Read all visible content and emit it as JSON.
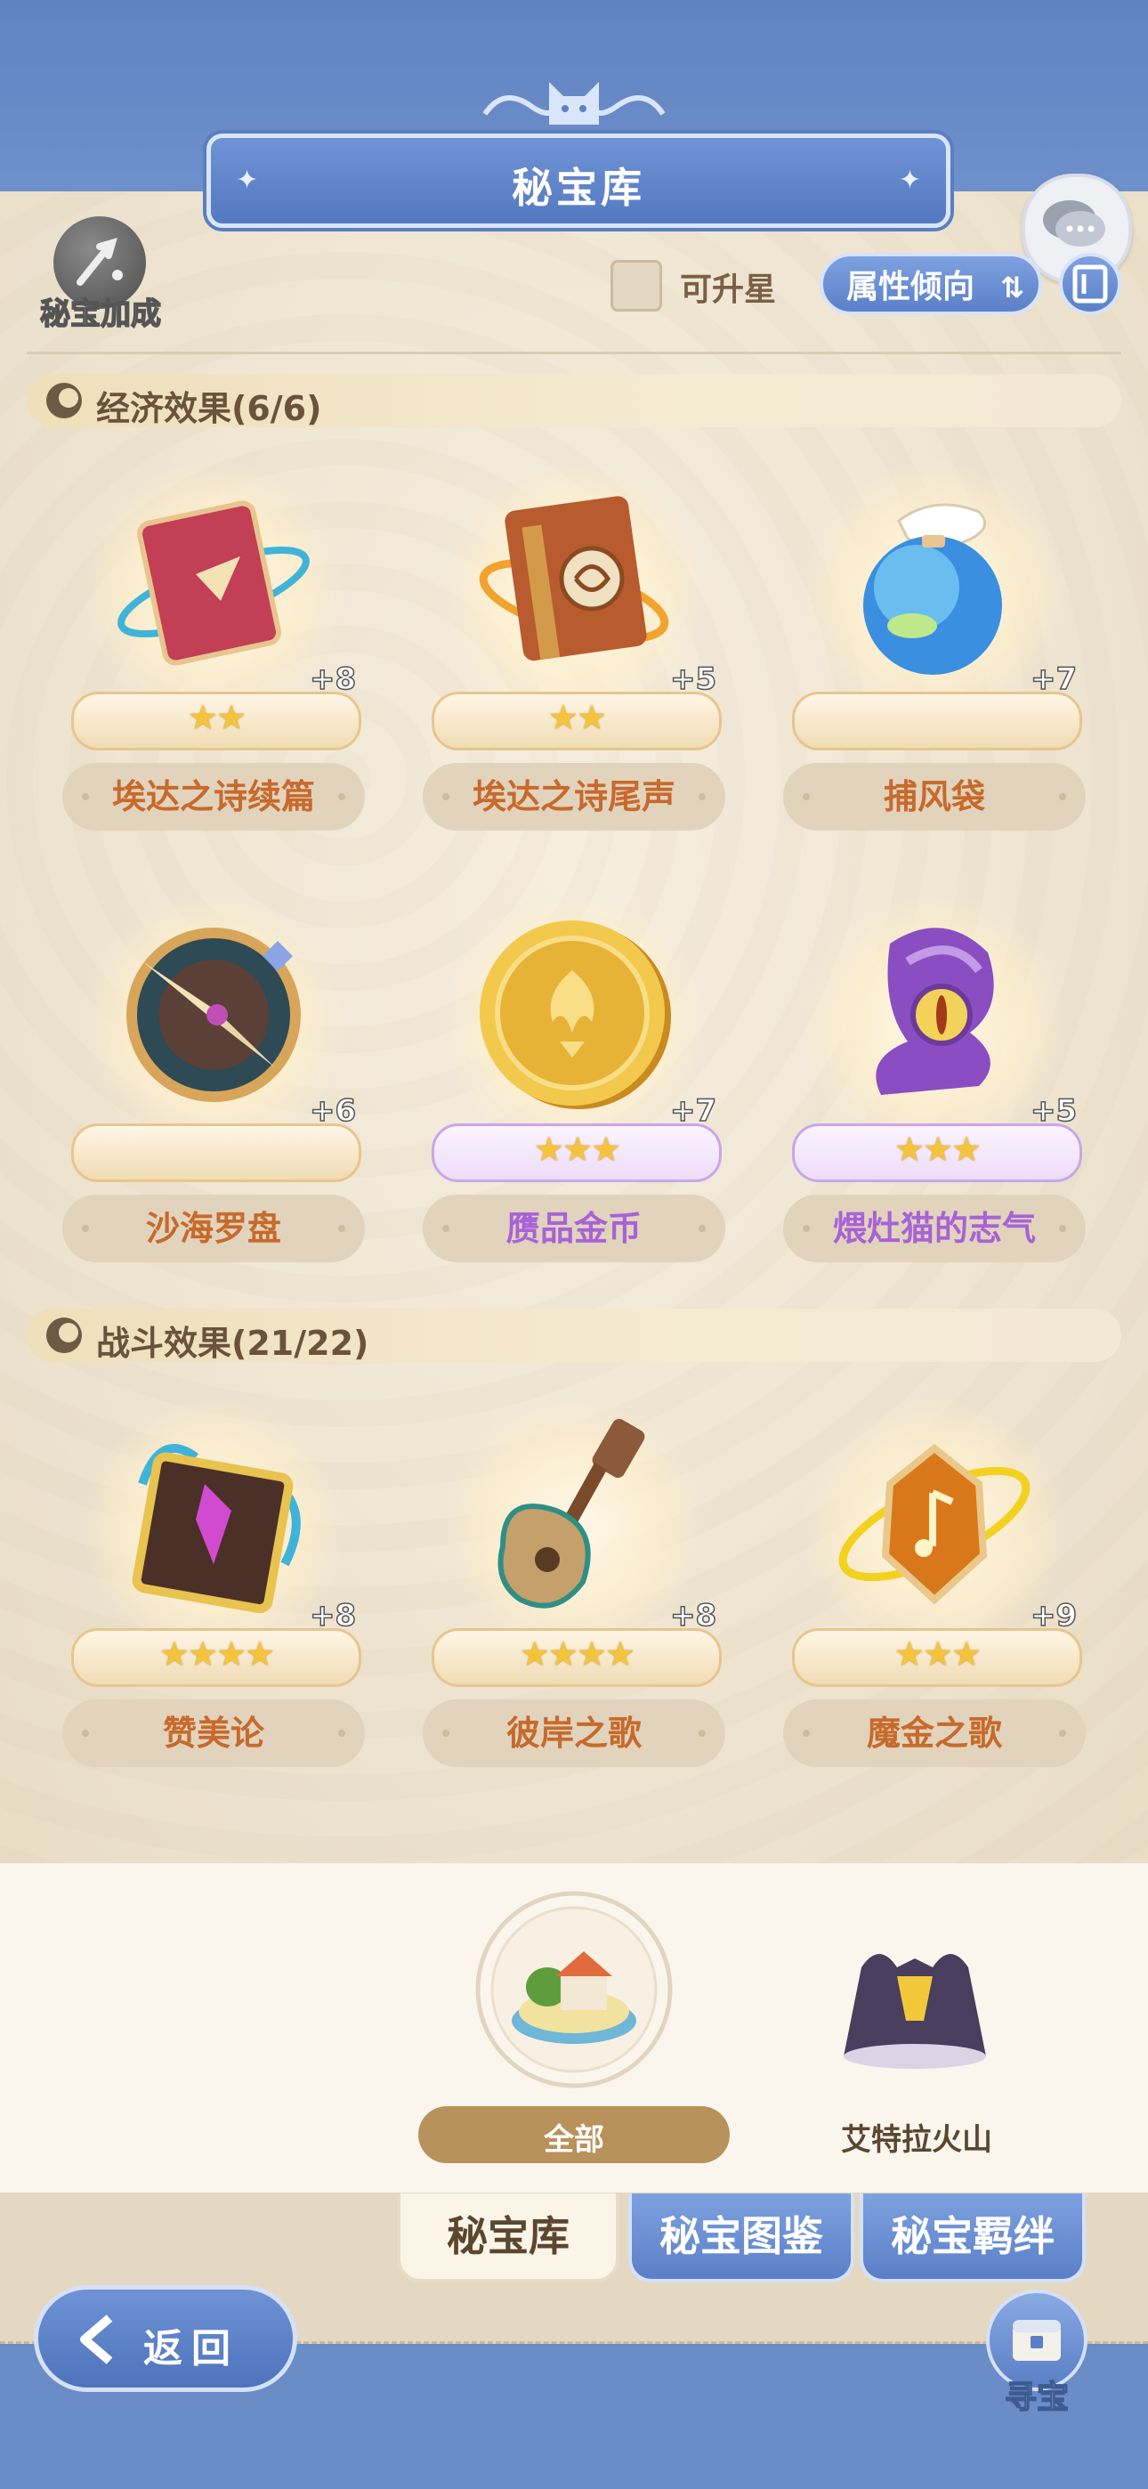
{
  "header": {
    "title": "秘宝库"
  },
  "toolbar": {
    "boost_label": "秘宝加成",
    "checkbox_label": "可升星",
    "attr_button_label": "属性倾向"
  },
  "sections": [
    {
      "title": "经济效果(6/6)",
      "items": [
        {
          "name": "埃达之诗续篇",
          "plus": "+8",
          "stars": 2,
          "rarity": "orange"
        },
        {
          "name": "埃达之诗尾声",
          "plus": "+5",
          "stars": 2,
          "rarity": "orange"
        },
        {
          "name": "捕风袋",
          "plus": "+7",
          "stars": 0,
          "rarity": "orange"
        },
        {
          "name": "沙海罗盘",
          "plus": "+6",
          "stars": 0,
          "rarity": "orange"
        },
        {
          "name": "赝品金币",
          "plus": "+7",
          "stars": 3,
          "rarity": "purple"
        },
        {
          "name": "煨灶猫的志气",
          "plus": "+5",
          "stars": 3,
          "rarity": "purple"
        }
      ]
    },
    {
      "title": "战斗效果(21/22)",
      "items": [
        {
          "name": "赞美论",
          "plus": "+8",
          "stars": 4,
          "rarity": "orange"
        },
        {
          "name": "彼岸之歌",
          "plus": "+8",
          "stars": 4,
          "rarity": "orange"
        },
        {
          "name": "魔金之歌",
          "plus": "+9",
          "stars": 3,
          "rarity": "orange"
        }
      ]
    }
  ],
  "regions": [
    {
      "label": "全部",
      "selected": true
    },
    {
      "label": "艾特拉火山",
      "selected": false
    }
  ],
  "tabs": [
    {
      "label": "秘宝库",
      "active": true
    },
    {
      "label": "秘宝图鉴",
      "active": false
    },
    {
      "label": "秘宝羁绊",
      "active": false
    }
  ],
  "footer": {
    "back_label": "返回",
    "seek_label": "寻宝"
  },
  "colors": {
    "accent_blue": "#5b80c8",
    "orange_name": "#c76a2b",
    "purple_name": "#a763d6",
    "star": "#f6c43a"
  }
}
